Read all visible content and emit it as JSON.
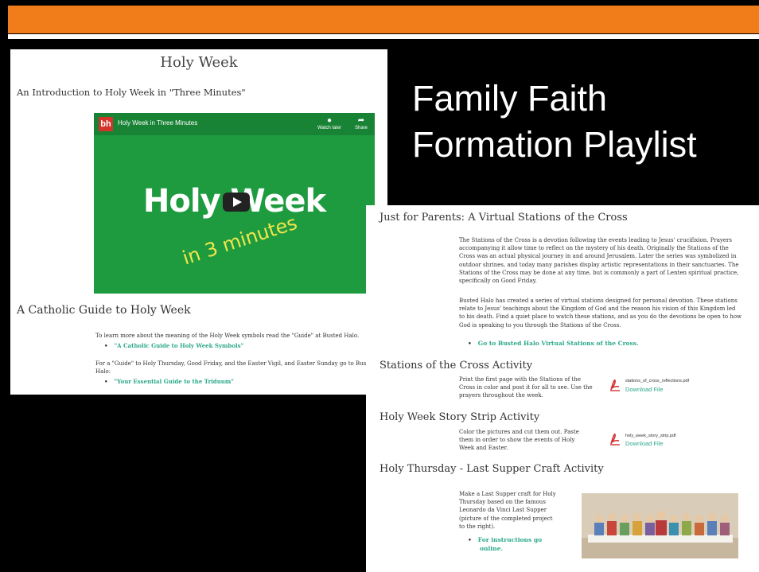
{
  "slide": {
    "title_line1": "Family Faith",
    "title_line2": "Formation Playlist"
  },
  "left_panel": {
    "heading": "Holy Week",
    "intro": "An Introduction to Holy Week in \"Three Minutes\"",
    "video": {
      "channel_logo": "bh",
      "title": "Holy Week in Three Minutes",
      "watch_later": "Watch later",
      "share": "Share",
      "big_text": "Holy Week",
      "sub_text": "in 3 minutes"
    },
    "section_heading": "A Catholic Guide to Holy Week",
    "para1": "To learn more about the meaning of the Holy Week symbols read the \"Guide\" at Busted Halo.",
    "link1": "\"A Catholic Guide to Holy Week Symbols\"",
    "para2": "For a \"Guide\" to Holy Thursday, Good Friday, and the Easter Vigil, and Easter Sunday go to Busted",
    "para2b": "Halo:",
    "link2": "\"Your Essential Guide to the Triduum\""
  },
  "right_panel": {
    "stations_heading": "Just for Parents: A Virtual Stations of the Cross",
    "stations_p1": [
      "The Stations of the Cross is a devotion following the events leading to Jesus' crucifixion. Prayers",
      "accompanying it allow time to reflect on the mystery of his death. Originally the Stations of the",
      "Cross was an actual physical journey in and around Jerusalem. Later the series was symbolized in",
      "outdoor shrines, and today many parishes display artistic representations in their sanctuaries. The",
      "Stations of the Cross may be done at any time, but is commonly a part of Lenten spiritual practice,",
      "specifically on Good Friday."
    ],
    "stations_p2": [
      "Busted Halo has created a series of virtual stations designed for personal devotion. These stations",
      "relate to Jesus' teachings about the Kingdom of God and the reason his vision of this Kingdom led",
      "to his death. Find a quiet place to watch these stations, and as you do the devotions be open to how",
      "God is speaking to you through the Stations of the Cross."
    ],
    "stations_link": "Go to Busted Halo Virtual Stations of the Cross.",
    "activity_heading": "Stations of the Cross Activity",
    "activity_p": [
      "Print the first page with the Stations of the",
      "Cross in color and post it for all to see. Use the",
      "prayers throughout the week."
    ],
    "activity_file": "stations_of_cross_reflections.pdf",
    "activity_download": "Download File",
    "strip_heading": "Holy Week Story Strip Activity",
    "strip_p": [
      "Color the pictures and cut them out. Paste",
      "them in order to show the events of Holy",
      "Week and Easter."
    ],
    "strip_file": "holy_week_story_strip.pdf",
    "strip_download": "Download File",
    "craft_heading": "Holy Thursday - Last Supper Craft Activity",
    "craft_p": [
      "Make a Last Supper craft for Holy",
      "Thursday based on the famous",
      "Leonardo da Vinci Last Supper",
      "(picture of the completed project",
      "to the right)."
    ],
    "craft_link1": "For instructions go",
    "craft_link2": "online."
  },
  "colors": {
    "orange": "#f07c1a",
    "link": "#2aa889",
    "video_green": "#1e9b3f"
  }
}
